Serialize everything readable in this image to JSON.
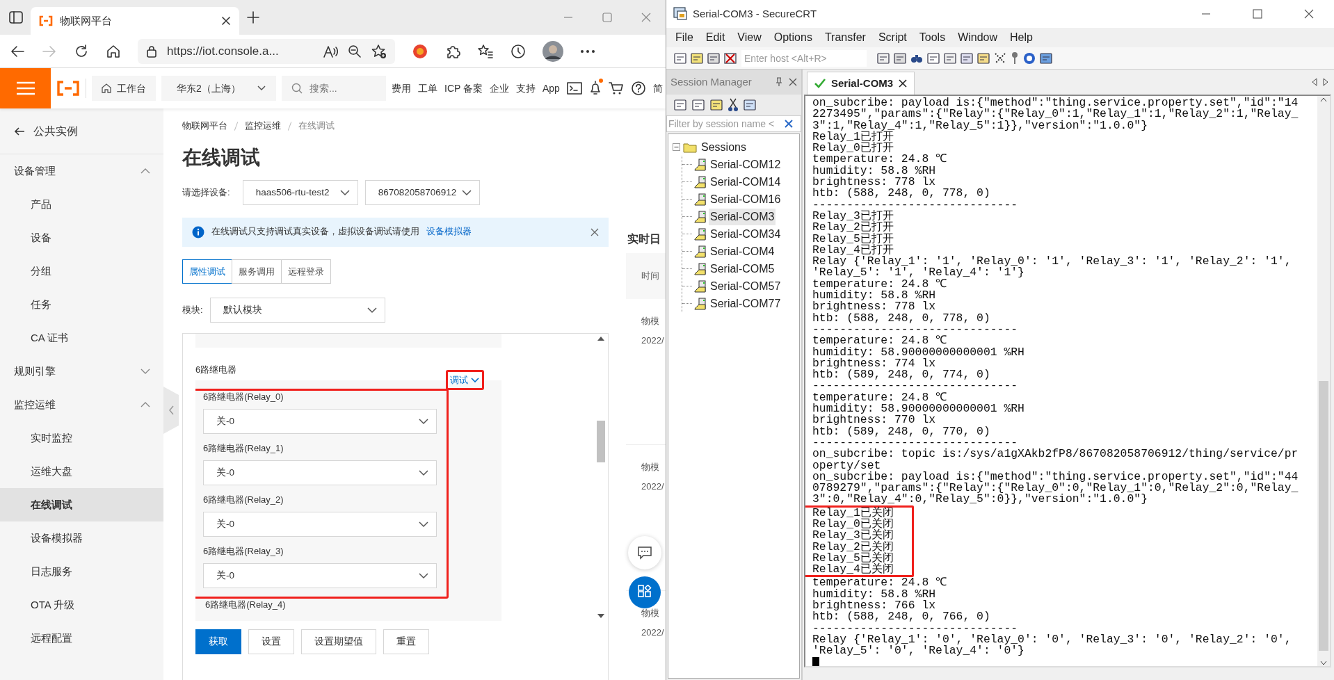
{
  "browser": {
    "tab_title": "物联网平台",
    "url": "https://iot.console.a..."
  },
  "console_header": {
    "workbench": "工作台",
    "region": "华东2（上海）",
    "search_placeholder": "搜索...",
    "links": [
      "费用",
      "工单",
      "ICP 备案",
      "企业",
      "支持",
      "App"
    ],
    "notification_dot": true,
    "language": "简"
  },
  "sidebar": {
    "back": "公共实例",
    "groups": [
      {
        "label": "设备管理",
        "expanded": true,
        "children": [
          {
            "label": "产品",
            "selected": false
          },
          {
            "label": "设备",
            "selected": false
          },
          {
            "label": "分组",
            "selected": false
          },
          {
            "label": "任务",
            "selected": false
          },
          {
            "label": "CA 证书",
            "selected": false
          }
        ]
      },
      {
        "label": "规则引擎",
        "expanded": false
      },
      {
        "label": "监控运维",
        "expanded": true,
        "children": [
          {
            "label": "实时监控",
            "selected": false
          },
          {
            "label": "运维大盘",
            "selected": false
          },
          {
            "label": "在线调试",
            "selected": true
          },
          {
            "label": "设备模拟器",
            "selected": false
          },
          {
            "label": "日志服务",
            "selected": false
          },
          {
            "label": "OTA 升级",
            "selected": false
          },
          {
            "label": "远程配置",
            "selected": false
          }
        ]
      }
    ]
  },
  "breadcrumb": [
    "物联网平台",
    "监控运维",
    "在线调试"
  ],
  "page_title": "在线调试",
  "device_select": {
    "label": "请选择设备:",
    "product": "haas506-rtu-test2",
    "device": "867082058706912"
  },
  "alert": {
    "text": "在线调试只支持调试真实设备，虚拟设备调试请使用",
    "link": "设备模拟器"
  },
  "tabs": [
    {
      "label": "属性调试",
      "selected": true
    },
    {
      "label": "服务调用",
      "selected": false
    },
    {
      "label": "远程登录",
      "selected": false
    }
  ],
  "module": {
    "label": "模块:",
    "value": "默认模块"
  },
  "property_panel": {
    "group": "6路继电器",
    "debug_menu": {
      "label": "调试",
      "highlighted": true
    },
    "fields": [
      {
        "label": "6路继电器(Relay_0)",
        "value": "关-0",
        "highlighted": true
      },
      {
        "label": "6路继电器(Relay_1)",
        "value": "关-0",
        "highlighted": true
      },
      {
        "label": "6路继电器(Relay_2)",
        "value": "关-0",
        "highlighted": true
      },
      {
        "label": "6路继电器(Relay_3)",
        "value": "关-0",
        "highlighted": true
      },
      {
        "label": "6路继电器(Relay_4)",
        "highlighted": false
      }
    ]
  },
  "actions": [
    {
      "label": "获取",
      "primary": true
    },
    {
      "label": "设置",
      "primary": false
    },
    {
      "label": "设置期望值",
      "primary": false
    },
    {
      "label": "重置",
      "primary": false
    }
  ],
  "realtime_log": {
    "title": "实时日",
    "column": "时间",
    "entries": [
      {
        "type": "物模",
        "time": "2022/"
      },
      {
        "type": "物模",
        "time": "2022/"
      },
      {
        "type": "物模",
        "time": "2022/"
      }
    ]
  },
  "securecrt": {
    "title": "Serial-COM3 - SecureCRT",
    "menu": [
      "File",
      "Edit",
      "View",
      "Options",
      "Transfer",
      "Script",
      "Tools",
      "Window",
      "Help"
    ],
    "host_placeholder": "Enter host <Alt+R>",
    "session_manager": {
      "title": "Session Manager",
      "filter_placeholder": "Filter by session name <",
      "root": {
        "label": "Sessions",
        "expanded": true,
        "children": [
          {
            "label": "Serial-COM12",
            "selected": false
          },
          {
            "label": "Serial-COM14",
            "selected": false
          },
          {
            "label": "Serial-COM16",
            "selected": false
          },
          {
            "label": "Serial-COM3",
            "selected": true
          },
          {
            "label": "Serial-COM34",
            "selected": false
          },
          {
            "label": "Serial-COM4",
            "selected": false
          },
          {
            "label": "Serial-COM5",
            "selected": false
          },
          {
            "label": "Serial-COM57",
            "selected": false
          },
          {
            "label": "Serial-COM77",
            "selected": false
          }
        ]
      }
    },
    "tab": {
      "label": "Serial-COM3",
      "connected": true
    },
    "terminal": {
      "lines": [
        {
          "text": "on_subcribe: payload is:{\"method\":\"thing.service.property.set\",\"id\":\"14",
          "highlighted": false
        },
        {
          "text": "2273495\",\"params\":{\"Relay\":{\"Relay_0\":1,\"Relay_1\":1,\"Relay_2\":1,\"Relay_",
          "highlighted": false
        },
        {
          "text": "3\":1,\"Relay_4\":1,\"Relay_5\":1}},\"version\":\"1.0.0\"}",
          "highlighted": false
        },
        {
          "text": "Relay_1已打开",
          "highlighted": false
        },
        {
          "text": "Relay_0已打开",
          "highlighted": false
        },
        {
          "text": "temperature: 24.8 ℃",
          "highlighted": false
        },
        {
          "text": "humidity: 58.8 %RH",
          "highlighted": false
        },
        {
          "text": "brightness: 778 lx",
          "highlighted": false
        },
        {
          "text": "htb: (588, 248, 0, 778, 0)",
          "highlighted": false
        },
        {
          "text": "------------------------------",
          "highlighted": false
        },
        {
          "text": "Relay_3已打开",
          "highlighted": false
        },
        {
          "text": "Relay_2已打开",
          "highlighted": false
        },
        {
          "text": "Relay_5已打开",
          "highlighted": false
        },
        {
          "text": "Relay_4已打开",
          "highlighted": false
        },
        {
          "text": "Relay {'Relay_1': '1', 'Relay_0': '1', 'Relay_3': '1', 'Relay_2': '1',",
          "highlighted": false
        },
        {
          "text": "'Relay_5': '1', 'Relay_4': '1'}",
          "highlighted": false
        },
        {
          "text": "temperature: 24.8 ℃",
          "highlighted": false
        },
        {
          "text": "humidity: 58.8 %RH",
          "highlighted": false
        },
        {
          "text": "brightness: 778 lx",
          "highlighted": false
        },
        {
          "text": "htb: (588, 248, 0, 778, 0)",
          "highlighted": false
        },
        {
          "text": "------------------------------",
          "highlighted": false
        },
        {
          "text": "temperature: 24.8 ℃",
          "highlighted": false
        },
        {
          "text": "humidity: 58.90000000000001 %RH",
          "highlighted": false
        },
        {
          "text": "brightness: 774 lx",
          "highlighted": false
        },
        {
          "text": "htb: (589, 248, 0, 774, 0)",
          "highlighted": false
        },
        {
          "text": "------------------------------",
          "highlighted": false
        },
        {
          "text": "temperature: 24.8 ℃",
          "highlighted": false
        },
        {
          "text": "humidity: 58.90000000000001 %RH",
          "highlighted": false
        },
        {
          "text": "brightness: 770 lx",
          "highlighted": false
        },
        {
          "text": "htb: (589, 248, 0, 770, 0)",
          "highlighted": false
        },
        {
          "text": "------------------------------",
          "highlighted": false
        },
        {
          "text": "on_subcribe: topic is:/sys/a1gXAkb2fP8/867082058706912/thing/service/pr",
          "highlighted": false
        },
        {
          "text": "operty/set",
          "highlighted": false
        },
        {
          "text": "on_subcribe: payload is:{\"method\":\"thing.service.property.set\",\"id\":\"44",
          "highlighted": false
        },
        {
          "text": "0789279\",\"params\":{\"Relay\":{\"Relay_0\":0,\"Relay_1\":0,\"Relay_2\":0,\"Relay_",
          "highlighted": false
        },
        {
          "text": "3\":0,\"Relay_4\":0,\"Relay_5\":0}},\"version\":\"1.0.0\"}",
          "highlighted": false
        },
        {
          "text": "Relay_1已关闭",
          "highlighted": true
        },
        {
          "text": "Relay_0已关闭",
          "highlighted": true
        },
        {
          "text": "Relay_3已关闭",
          "highlighted": true
        },
        {
          "text": "Relay_2已关闭",
          "highlighted": true
        },
        {
          "text": "Relay_5已关闭",
          "highlighted": true
        },
        {
          "text": "Relay_4已关闭",
          "highlighted": true
        },
        {
          "text": "temperature: 24.8 ℃",
          "highlighted": false
        },
        {
          "text": "humidity: 58.8 %RH",
          "highlighted": false
        },
        {
          "text": "brightness: 766 lx",
          "highlighted": false
        },
        {
          "text": "htb: (588, 248, 0, 766, 0)",
          "highlighted": false
        },
        {
          "text": "------------------------------",
          "highlighted": false
        },
        {
          "text": "Relay {'Relay_1': '0', 'Relay_0': '0', 'Relay_3': '0', 'Relay_2': '0',",
          "highlighted": false
        },
        {
          "text": "'Relay_5': '0', 'Relay_4': '0'}",
          "highlighted": false
        }
      ],
      "cursor": true
    }
  }
}
